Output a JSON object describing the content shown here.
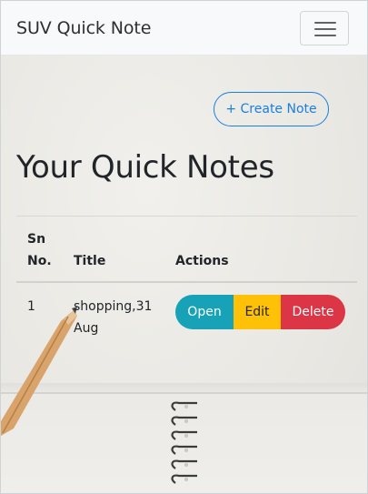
{
  "navbar": {
    "brand": "SUV Quick Note",
    "toggler_icon": "hamburger-menu-icon"
  },
  "actions": {
    "create_label": "+ Create Note"
  },
  "page": {
    "title": "Your Quick Notes"
  },
  "table": {
    "headers": {
      "sn_line1": "Sn",
      "sn_line2": "No.",
      "title": "Title",
      "actions": "Actions"
    },
    "rows": [
      {
        "sn": "1",
        "title_line1": "shopping,31",
        "title_line2": "Aug",
        "open_label": "Open",
        "edit_label": "Edit",
        "delete_label": "Delete"
      }
    ]
  },
  "colors": {
    "open": "#17a2b8",
    "edit": "#ffc107",
    "delete": "#dc3545",
    "create_outline": "#1a7fe0",
    "navbar_bg": "#f8f9fa"
  }
}
